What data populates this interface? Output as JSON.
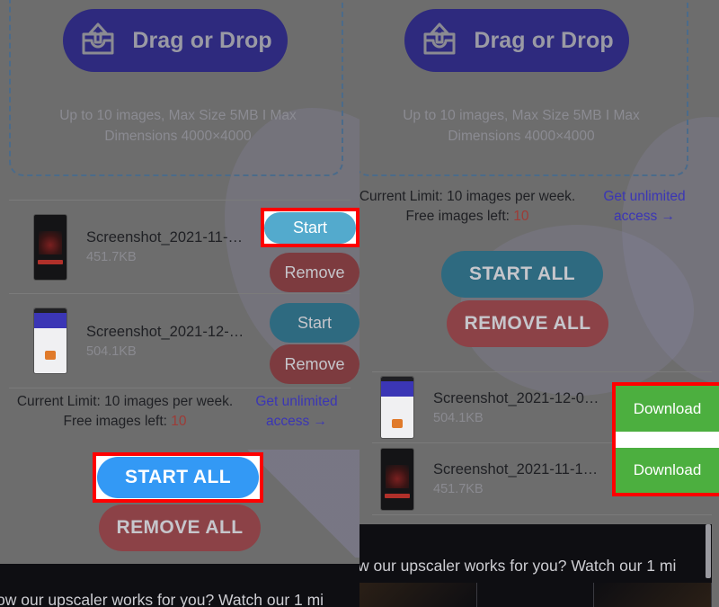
{
  "app": {
    "background_color": "#6d6d6d",
    "accent_primary": "#2e2a7e",
    "highlight_color": "#ff0000",
    "link_color": "#3b36b5",
    "download_color": "#4caf3f"
  },
  "dropzone": {
    "button_label": "Drag or Drop",
    "icon": "upload-tray-icon",
    "note_line1": "Up to 10 images, Max Size 5MB I Max",
    "note_line2": "Dimensions 4000×4000"
  },
  "limit": {
    "text_line1": "Current Limit: 10 images per week.",
    "text_line2_prefix": "Free images left: ",
    "text_line2_value": "10",
    "link_line1": "Get unlimited",
    "link_line2": "access →"
  },
  "actions": {
    "start_all": "START ALL",
    "remove_all": "REMOVE ALL",
    "start": "Start",
    "remove": "Remove",
    "download": "Download"
  },
  "left_panel": {
    "files": [
      {
        "name": "Screenshot_2021-11-…",
        "size": "451.7KB",
        "thumb": "dark-game-app-thumbnail",
        "start_label": "Start",
        "remove_label": "Remove",
        "highlighted": true
      },
      {
        "name": "Screenshot_2021-12-…",
        "size": "504.1KB",
        "thumb": "light-receipt-app-thumbnail",
        "start_label": "Start",
        "remove_label": "Remove",
        "highlighted": false
      }
    ]
  },
  "right_panel": {
    "files": [
      {
        "name": "Screenshot_2021-12-0…",
        "size": "504.1KB",
        "thumb": "light-receipt-app-thumbnail",
        "download_label": "Download"
      },
      {
        "name": "Screenshot_2021-11-1…",
        "size": "451.7KB",
        "thumb": "dark-game-app-thumbnail",
        "download_label": "Download"
      }
    ]
  },
  "video_banner": {
    "caption": "w our upscaler works for you? Watch our 1 mi",
    "caption_left": "ow our upscaler works for you? Watch our 1 mi"
  }
}
